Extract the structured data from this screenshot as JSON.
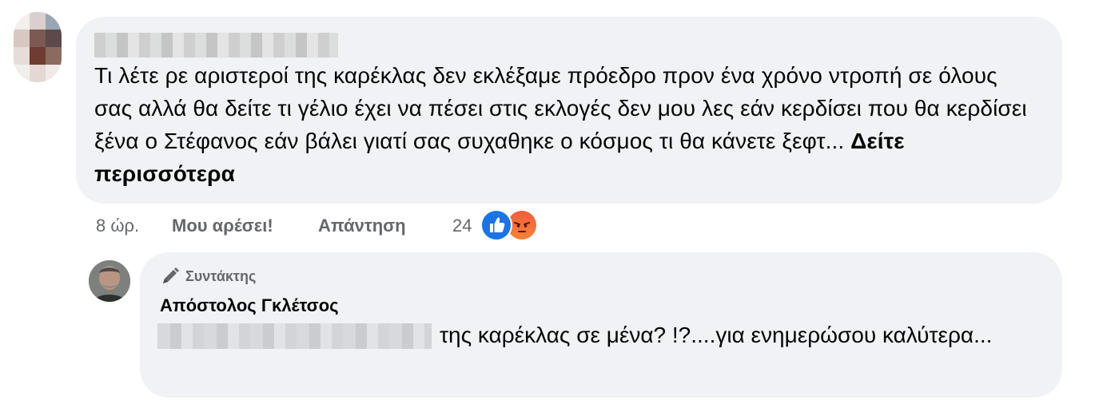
{
  "comment": {
    "author_name": "",
    "text": "Τι λέτε ρε αριστεροί της καρέκλας δεν εκλέξαμε πρόεδρο πρoν ένα χρόνο ντροπή σε όλους σας αλλά θα δείτε τι γέλιο έχει να πέσει στις εκλογές δεν μου λες εάν κερδίσει που θα κερδίσει ξένα ο Στέφανος εάν βάλει γιατί σας συχαθηκε ο κόσμος τι θα κάνετε ξεφτ...",
    "see_more_label": "Δείτε περισσότερα",
    "time": "8 ώρ.",
    "like_label": "Μου αρέσει!",
    "reply_label": "Απάντηση",
    "reaction_count": "24",
    "reaction_icons": [
      "like-reaction-icon",
      "angry-reaction-icon"
    ]
  },
  "reply": {
    "badge_label": "Συντάκτης",
    "author_name": "Απόστολος Γκλέτσος",
    "text": "της καρέκλας σε μένα? !?....για ενημερώσου καλύτερα..."
  },
  "colors": {
    "bubble_bg": "#f0f2f5",
    "secondary_text": "#65676b",
    "like_blue": "#1b74e4",
    "angry_orange": "#f15c3c"
  }
}
